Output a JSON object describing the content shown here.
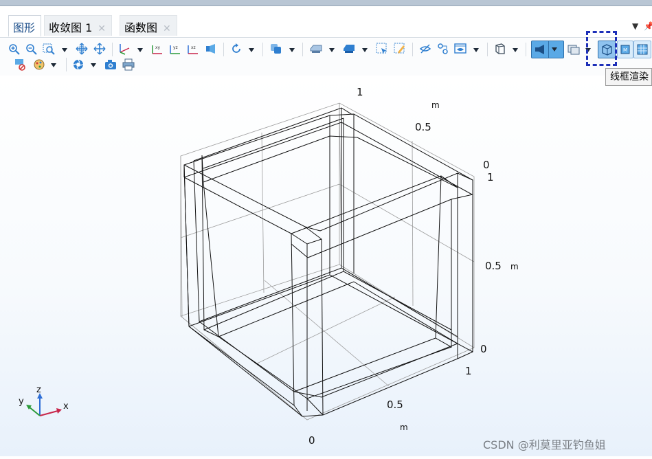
{
  "tabs": [
    {
      "label": "图形",
      "active": true,
      "closable": false
    },
    {
      "label": "收敛图 1",
      "active": false,
      "closable": true
    },
    {
      "label": "函数图",
      "active": false,
      "closable": true
    }
  ],
  "tab_controls": {
    "menu_icon": "dropdown-triangle-icon",
    "pin_icon": "pin-icon"
  },
  "toolbar": {
    "row1": [
      "zoom-in-icon",
      "zoom-out-icon",
      "zoom-box-icon",
      "zoom-extents-icon",
      "zoom-selected-icon",
      "view-default-icon",
      "view-xy-icon",
      "view-yz-icon",
      "view-xz-icon",
      "scene-light-icon",
      "rotate-icon",
      "transparency-icon",
      "selection-icon",
      "scene-icon",
      "select-box-icon",
      "clear-selection-icon",
      "hide-icon",
      "show-icon",
      "visibility-icon",
      "perspective-icon",
      "render-mode-icon",
      "dropdown-icon",
      "window-icon",
      "wireframe-render-icon",
      "surface-render-icon",
      "grid-render-icon"
    ],
    "row2": [
      "reset-view-icon",
      "colors-icon",
      "image-snapshot-icon",
      "camera-icon",
      "print-icon"
    ]
  },
  "tooltip": "线框渲染",
  "highlight_target": "wireframe-render-button",
  "axes": {
    "x_ticks": [
      "0",
      "0.5",
      "1"
    ],
    "x_unit": "m",
    "y_ticks": [
      "0",
      "0.5",
      "1"
    ],
    "y_unit": "m",
    "z_ticks": [
      "0",
      "0.5",
      "1"
    ],
    "z_unit": "m"
  },
  "triad": {
    "x": "x",
    "y": "y",
    "z": "z"
  },
  "watermark": "CSDN @利莫里亚钓鱼姐",
  "colors": {
    "triad_x": "#c8254a",
    "triad_y": "#2b9b3a",
    "triad_z": "#2e6ed6",
    "highlight": "#1d2fb8",
    "active_button": "#5aa9e6"
  }
}
